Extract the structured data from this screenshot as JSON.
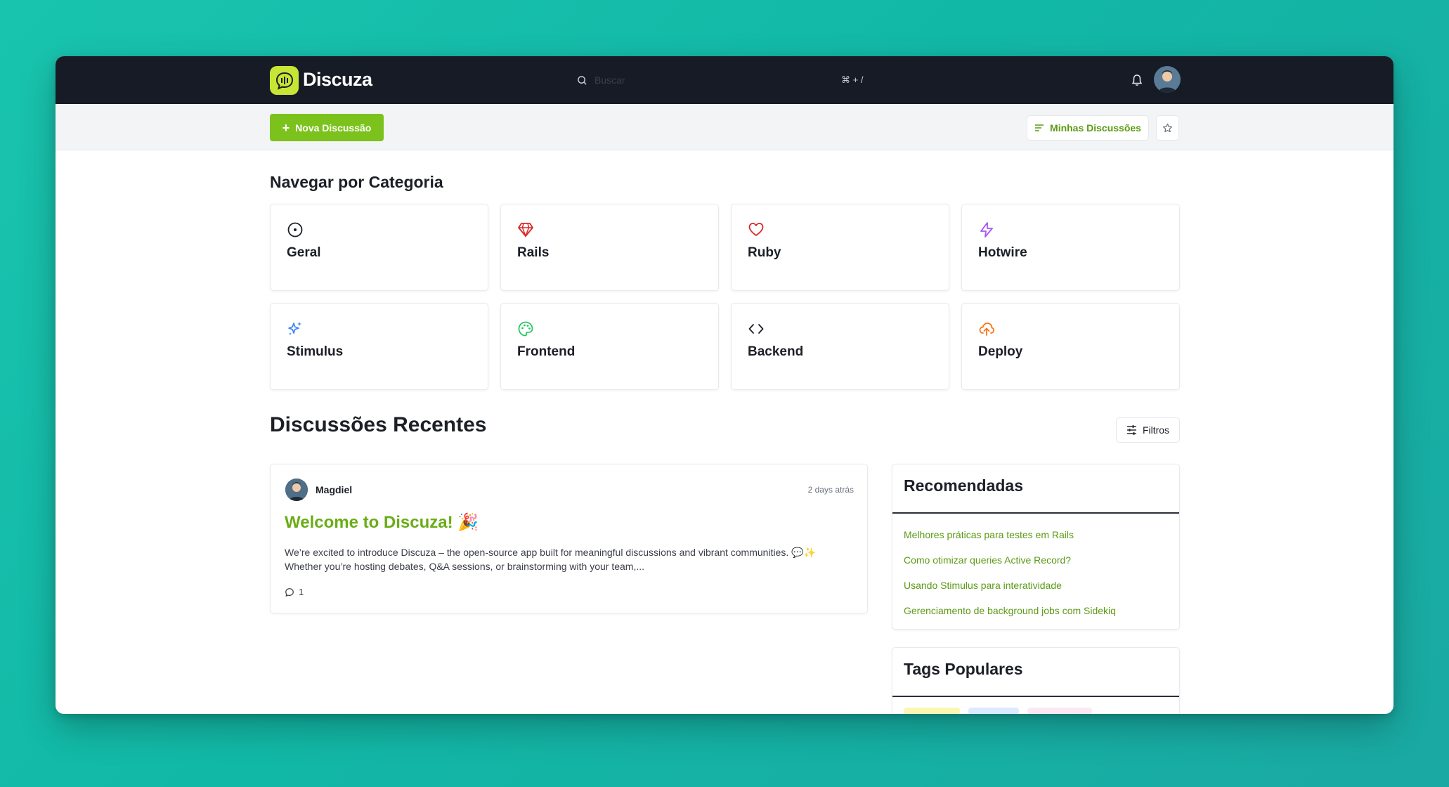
{
  "app": {
    "name": "Discuza",
    "brand_color": "#c7e534",
    "accent_color": "#7cc21c"
  },
  "header": {
    "search_placeholder": "Buscar",
    "search_shortcut": "⌘ + /",
    "icons": [
      "search-icon",
      "bell-icon",
      "avatar"
    ]
  },
  "toolbar": {
    "new_discussion_label": "Nova Discussão",
    "my_discussions_label": "Minhas Discussões"
  },
  "categories": {
    "title": "Navegar por Categoria",
    "items": [
      {
        "label": "Geral",
        "icon": "compass-icon",
        "color": "#1c1f27"
      },
      {
        "label": "Rails",
        "icon": "gem-icon",
        "color": "#dc2626"
      },
      {
        "label": "Ruby",
        "icon": "heart-icon",
        "color": "#dc2626"
      },
      {
        "label": "Hotwire",
        "icon": "zap-icon",
        "color": "#a855f7"
      },
      {
        "label": "Stimulus",
        "icon": "sparkles-icon",
        "color": "#3b82f6"
      },
      {
        "label": "Frontend",
        "icon": "palette-icon",
        "color": "#22c55e"
      },
      {
        "label": "Backend",
        "icon": "code-icon",
        "color": "#1c1f27"
      },
      {
        "label": "Deploy",
        "icon": "cloud-upload-icon",
        "color": "#f97316"
      }
    ]
  },
  "discussions": {
    "title": "Discussões Recentes",
    "filter_label": "Filtros",
    "posts": [
      {
        "author": "Magdiel",
        "time": "2 days atrás",
        "title": "Welcome to Discuza! 🎉",
        "excerpt_line1": "We’re excited to introduce Discuza – the open-source app built for meaningful discussions and vibrant communities. 💬✨",
        "excerpt_line2": "Whether you’re hosting debates, Q&A sessions, or brainstorming with your team,...",
        "comments": "1"
      }
    ]
  },
  "sidebar": {
    "recommended_title": "Recomendadas",
    "recommended": [
      "Melhores práticas para testes em Rails",
      "Como otimizar queries Active Record?",
      "Usando Stimulus para interatividade",
      "Gerenciamento de background jobs com Sidekiq"
    ],
    "tags_title": "Tags Populares"
  }
}
